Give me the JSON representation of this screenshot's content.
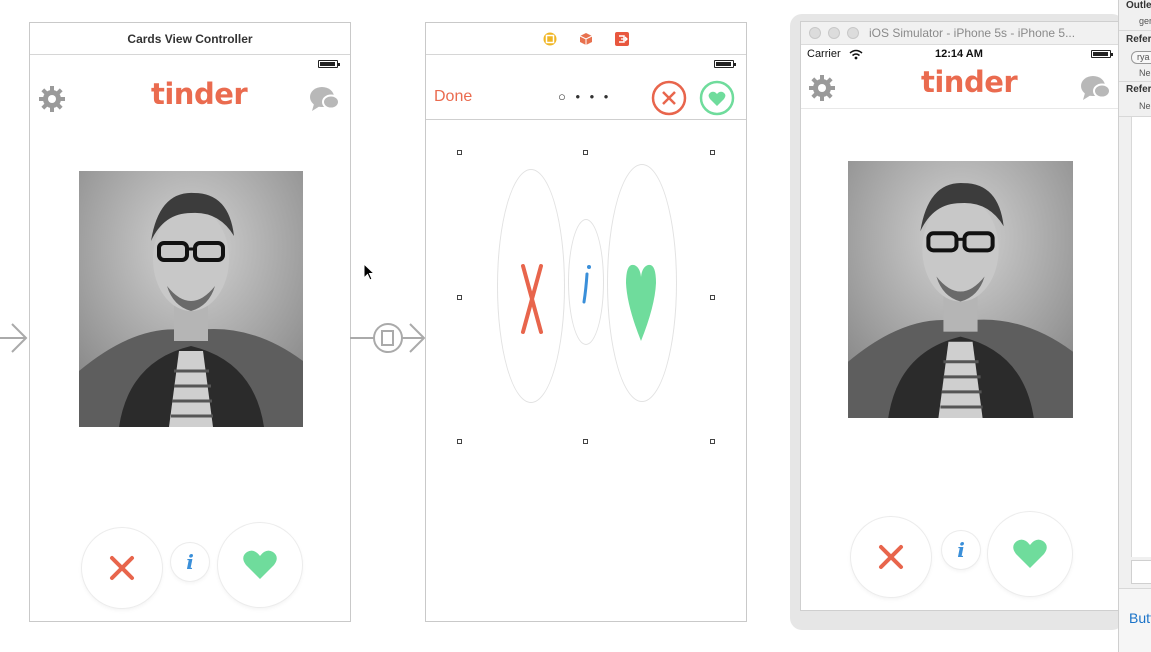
{
  "scene1": {
    "title": "Cards View Controller",
    "logo": "tinder"
  },
  "scene2": {
    "done_label": "Done",
    "toolbar_icons": [
      "view-controller-icon",
      "first-responder-icon",
      "exit-icon"
    ],
    "page_indicator": "○ • • •"
  },
  "simulator": {
    "window_title": "iOS Simulator - iPhone 5s - iPhone 5...",
    "carrier": "Carrier",
    "time": "12:14 AM",
    "logo": "tinder"
  },
  "inspector": {
    "outlets_label": "Outle",
    "outlets_item": "ger",
    "referencing_1": "Refer",
    "referencing_1_item": "rya",
    "referencing_1_sub": "Ne",
    "referencing_2": "Refer",
    "referencing_2_sub": "Ne",
    "button_label": "Butt"
  },
  "colors": {
    "tinder_orange": "#ea6b4f",
    "like_green": "#6fdc9c",
    "info_blue": "#3a8fd9",
    "nope_red": "#e8654c"
  }
}
